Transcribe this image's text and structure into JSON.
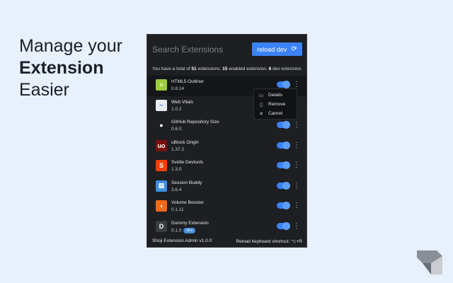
{
  "promo": {
    "line1": "Manage your",
    "line2": "Extension",
    "line3": "Easier"
  },
  "popup": {
    "search": {
      "placeholder": "Search Extensions",
      "value": ""
    },
    "reload_button": {
      "label": "reload dev",
      "icon": "refresh-icon"
    },
    "summary": {
      "prefix": "You have a total of ",
      "total": "51",
      "middle1": " extensions. ",
      "enabled": "15",
      "middle2": " enabled extension. ",
      "dev": "6",
      "suffix": " dev extension."
    },
    "extensions": [
      {
        "name": "HTML5 Outliner",
        "version": "0.8.14",
        "enabled": true,
        "icon": "html5-outliner-icon",
        "color": "#9ccc3c",
        "glyph": "≡",
        "dev": false
      },
      {
        "name": "Web Vitals",
        "version": "1.0.2",
        "enabled": true,
        "icon": "web-vitals-icon",
        "color": "#e9edf3",
        "glyph": "~",
        "dev": false
      },
      {
        "name": "GitHub Repository Size",
        "version": "0.6.0",
        "enabled": true,
        "icon": "github-icon",
        "color": "#1e1f23",
        "glyph": "●",
        "dev": false
      },
      {
        "name": "uBlock Origin",
        "version": "1.37.2",
        "enabled": true,
        "icon": "ublock-icon",
        "color": "#7a1010",
        "glyph": "uo",
        "dev": false
      },
      {
        "name": "Svelte Devtools",
        "version": "1.3.0",
        "enabled": true,
        "icon": "svelte-icon",
        "color": "#ff3e00",
        "glyph": "S",
        "dev": false
      },
      {
        "name": "Session Buddy",
        "version": "3.6.4",
        "enabled": true,
        "icon": "session-buddy-icon",
        "color": "#3d8ee0",
        "glyph": "▤",
        "dev": false
      },
      {
        "name": "Volume Booster",
        "version": "0.1.11",
        "enabled": true,
        "icon": "volume-booster-icon",
        "color": "#f06a1c",
        "glyph": "◖",
        "dev": false
      },
      {
        "name": "Dummy Extension",
        "version": "0.1.0",
        "enabled": true,
        "icon": "dummy-extension-icon",
        "color": "#3a3c41",
        "glyph": "D",
        "dev": true,
        "badge": "dev"
      }
    ],
    "context_menu": [
      {
        "label": "Details",
        "icon": "details-icon"
      },
      {
        "label": "Remove",
        "icon": "trash-icon"
      },
      {
        "label": "Cancel",
        "icon": "close-icon"
      }
    ],
    "footer": {
      "left": "Shoji Extension Admin v1.0.0",
      "right": "Reload keyboard shortcut: ⌥+R"
    }
  },
  "colors": {
    "accent": "#3b82f6",
    "panel_bg": "#1e1f23",
    "page_bg": "#e8f0fb"
  }
}
